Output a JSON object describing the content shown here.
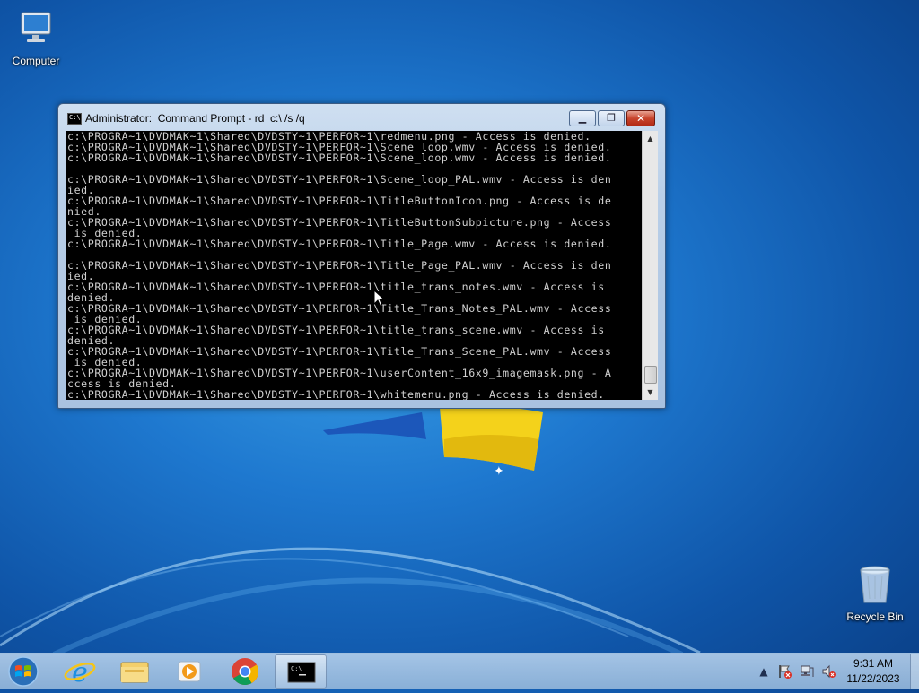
{
  "desktop": {
    "icons": [
      {
        "label": "Computer",
        "icon": "computer-icon"
      },
      {
        "label": "Recycle Bin",
        "icon": "recycle-bin-icon"
      }
    ]
  },
  "window": {
    "title": "Administrator:  Command Prompt - rd  c:\\ /s /q",
    "icon": "cmd-icon",
    "controls": {
      "minimize": "minimize-icon",
      "maximize": "maximize-icon",
      "close": "close-icon"
    },
    "console_lines": [
      "c:\\PROGRA~1\\DVDMAK~1\\Shared\\DVDSTY~1\\PERFOR~1\\redmenu.png - Access is denied.",
      "c:\\PROGRA~1\\DVDMAK~1\\Shared\\DVDSTY~1\\PERFOR~1\\Scene loop.wmv - Access is denied.",
      "c:\\PROGRA~1\\DVDMAK~1\\Shared\\DVDSTY~1\\PERFOR~1\\Scene_loop.wmv - Access is denied.",
      "",
      "c:\\PROGRA~1\\DVDMAK~1\\Shared\\DVDSTY~1\\PERFOR~1\\Scene_loop_PAL.wmv - Access is den",
      "ied.",
      "c:\\PROGRA~1\\DVDMAK~1\\Shared\\DVDSTY~1\\PERFOR~1\\TitleButtonIcon.png - Access is de",
      "nied.",
      "c:\\PROGRA~1\\DVDMAK~1\\Shared\\DVDSTY~1\\PERFOR~1\\TitleButtonSubpicture.png - Access",
      " is denied.",
      "c:\\PROGRA~1\\DVDMAK~1\\Shared\\DVDSTY~1\\PERFOR~1\\Title_Page.wmv - Access is denied.",
      "",
      "c:\\PROGRA~1\\DVDMAK~1\\Shared\\DVDSTY~1\\PERFOR~1\\Title_Page_PAL.wmv - Access is den",
      "ied.",
      "c:\\PROGRA~1\\DVDMAK~1\\Shared\\DVDSTY~1\\PERFOR~1\\title_trans_notes.wmv - Access is",
      "denied.",
      "c:\\PROGRA~1\\DVDMAK~1\\Shared\\DVDSTY~1\\PERFOR~1\\Title_Trans_Notes_PAL.wmv - Access",
      " is denied.",
      "c:\\PROGRA~1\\DVDMAK~1\\Shared\\DVDSTY~1\\PERFOR~1\\title_trans_scene.wmv - Access is",
      "denied.",
      "c:\\PROGRA~1\\DVDMAK~1\\Shared\\DVDSTY~1\\PERFOR~1\\Title_Trans_Scene_PAL.wmv - Access",
      " is denied.",
      "c:\\PROGRA~1\\DVDMAK~1\\Shared\\DVDSTY~1\\PERFOR~1\\userContent_16x9_imagemask.png - A",
      "ccess is denied.",
      "c:\\PROGRA~1\\DVDMAK~1\\Shared\\DVDSTY~1\\PERFOR~1\\whitemenu.png - Access is denied."
    ]
  },
  "taskbar": {
    "start": "windows-start-icon",
    "pinned": [
      {
        "name": "internet-explorer-icon"
      },
      {
        "name": "file-explorer-icon"
      },
      {
        "name": "media-player-icon"
      },
      {
        "name": "chrome-icon"
      },
      {
        "name": "cmd-icon",
        "active": true
      }
    ],
    "tray": {
      "icons": [
        "show-hidden-icons-icon",
        "action-center-icon",
        "network-icon",
        "volume-muted-icon"
      ],
      "time": "9:31 AM",
      "date": "11/22/2023"
    }
  },
  "colors": {
    "console_bg": "#000000",
    "console_text": "#d0d0d0",
    "close_button": "#c8452d",
    "desktop_blue": "#1e78cf"
  }
}
